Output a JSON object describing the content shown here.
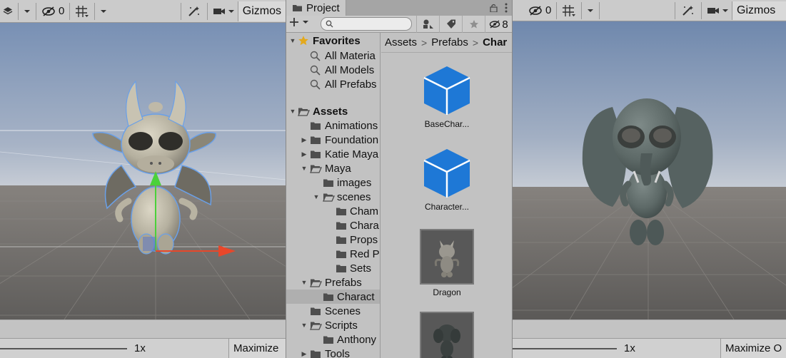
{
  "left_scene": {
    "toolbar": {
      "visibility_count": "0",
      "gizmos_label": "Gizmos"
    },
    "bottom": {
      "scale_label": "1x",
      "maximize_label": "Maximize"
    }
  },
  "project": {
    "tab_label": "Project",
    "search_placeholder": "",
    "hidden_count": "8",
    "favorites": {
      "label": "Favorites",
      "items": [
        "All Materia",
        "All Models",
        "All Prefabs"
      ]
    },
    "tree": [
      {
        "label": "Assets"
      },
      {
        "label": "Animations"
      },
      {
        "label": "Foundation"
      },
      {
        "label": "Katie Maya"
      },
      {
        "label": "Maya"
      },
      {
        "label": "images"
      },
      {
        "label": "scenes"
      },
      {
        "label": "Cham"
      },
      {
        "label": "Chara"
      },
      {
        "label": "Props"
      },
      {
        "label": "Red P"
      },
      {
        "label": "Sets"
      },
      {
        "label": "Prefabs"
      },
      {
        "label": "Charact"
      },
      {
        "label": "Scenes"
      },
      {
        "label": "Scripts"
      },
      {
        "label": "Anthony"
      },
      {
        "label": "Tools"
      }
    ],
    "breadcrumb": [
      "Assets",
      "Prefabs",
      "Char"
    ],
    "assets": [
      {
        "label": "BaseChar..."
      },
      {
        "label": "Character..."
      },
      {
        "label": "Dragon"
      },
      {
        "label": ""
      }
    ]
  },
  "right_scene": {
    "toolbar": {
      "visibility_count": "0",
      "gizmos_label": "Gizmos"
    },
    "bottom": {
      "scale_label": "1x",
      "maximize_label": "Maximize O"
    }
  },
  "colors": {
    "sky_top": "#7c93b6",
    "sky_horizon": "#c3cad4",
    "ground": "#6e6c6a",
    "prefab_blue": "#1e78d6",
    "selection_outline": "#6aa0e8",
    "gizmo_green": "#4bd13a",
    "gizmo_red": "#e8472a",
    "dragon": "#b9b4a4",
    "elephant": "#5d6967"
  }
}
